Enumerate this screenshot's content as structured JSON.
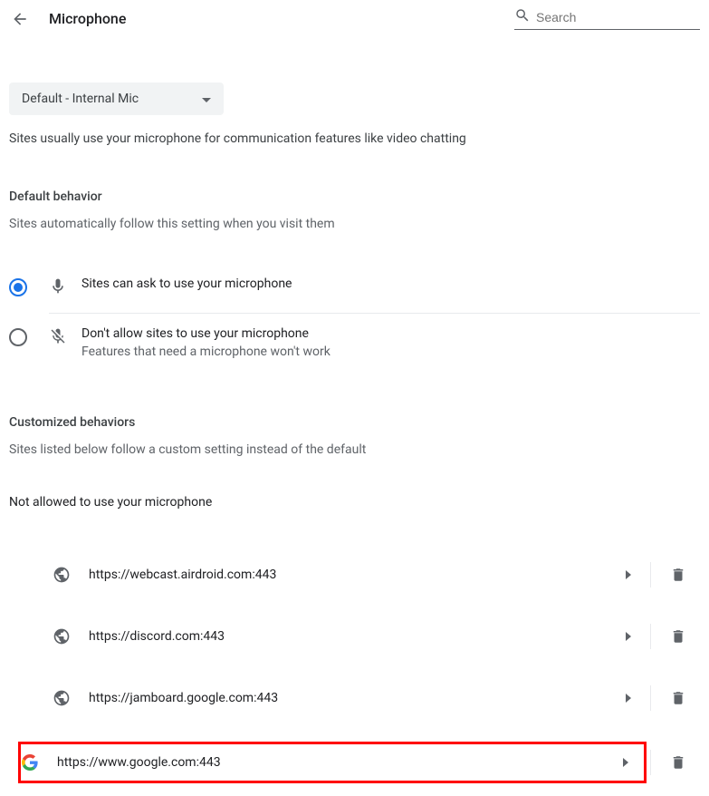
{
  "header": {
    "title": "Microphone",
    "search_placeholder": "Search"
  },
  "dropdown": {
    "selected": "Default - Internal Mic"
  },
  "description": "Sites usually use your microphone for communication features like video chatting",
  "default_behavior": {
    "title": "Default behavior",
    "subtitle": "Sites automatically follow this setting when you visit them",
    "options": [
      {
        "label": "Sites can ask to use your microphone",
        "sublabel": "",
        "selected": true
      },
      {
        "label": "Don't allow sites to use your microphone",
        "sublabel": "Features that need a microphone won't work",
        "selected": false
      }
    ]
  },
  "customized": {
    "title": "Customized behaviors",
    "subtitle": "Sites listed below follow a custom setting instead of the default"
  },
  "not_allowed": {
    "title": "Not allowed to use your microphone",
    "sites": [
      {
        "url": "https://webcast.airdroid.com:443",
        "icon": "globe",
        "highlighted": false
      },
      {
        "url": "https://discord.com:443",
        "icon": "globe",
        "highlighted": false
      },
      {
        "url": "https://jamboard.google.com:443",
        "icon": "globe",
        "highlighted": false
      },
      {
        "url": "https://www.google.com:443",
        "icon": "google",
        "highlighted": true
      }
    ]
  }
}
